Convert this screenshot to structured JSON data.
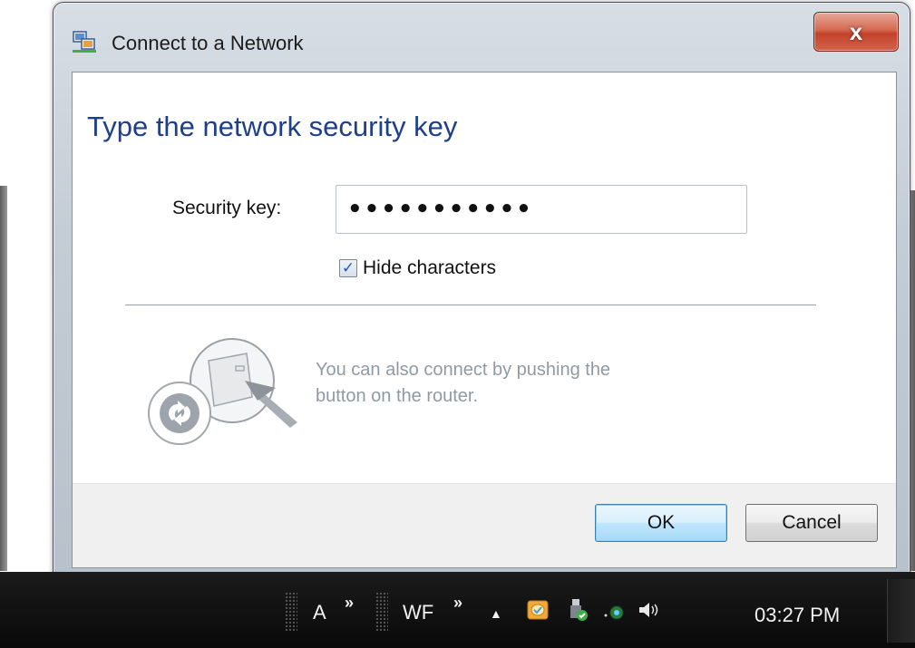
{
  "window": {
    "title": "Connect to a Network",
    "close_label": "x"
  },
  "dialog": {
    "heading": "Type the network security key",
    "security_key_label": "Security key:",
    "security_key_value": "•••••••••••",
    "hide_characters_label": "Hide characters",
    "hide_characters_checked": true,
    "push_button_text_line1": "You can also connect by pushing the",
    "push_button_text_line2": "button on the router."
  },
  "buttons": {
    "ok": "OK",
    "cancel": "Cancel"
  },
  "taskbar": {
    "toolbar_a": "A",
    "toolbar_wf": "WF",
    "chevron": "»",
    "tray_expand": "▲",
    "clock": "03:27 PM",
    "tray_icons": [
      "outlook-icon",
      "usb-safely-remove-icon",
      "network-icon",
      "volume-icon"
    ]
  },
  "colors": {
    "heading": "#1e3f8a",
    "close_button": "#c2432a",
    "taskbar": "#0a0a0a"
  }
}
